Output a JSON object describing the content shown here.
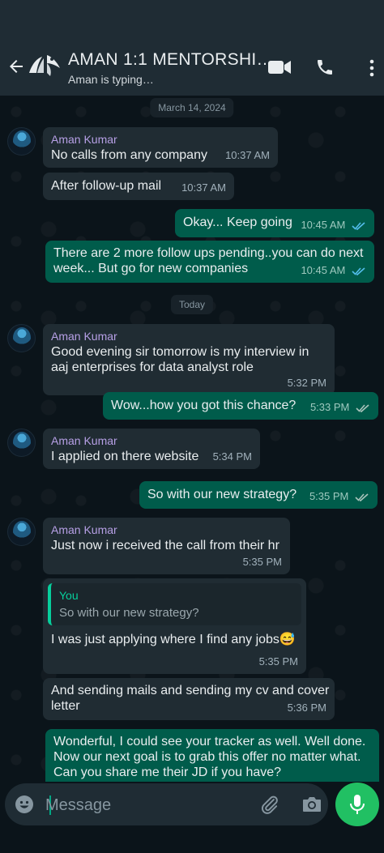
{
  "header": {
    "title": "AMAN 1:1 MENTORSHI…",
    "status": "Aman is typing…"
  },
  "chat": {
    "dates": [
      "March 14, 2024",
      "Today"
    ],
    "messages": [
      {
        "dir": "in",
        "sender": "Aman Kumar",
        "text": "No calls from any company",
        "time": "10:37 AM"
      },
      {
        "dir": "in",
        "text": "After follow-up mail",
        "time": "10:37 AM"
      },
      {
        "dir": "out",
        "text": "Okay... Keep going",
        "time": "10:45 AM"
      },
      {
        "dir": "out",
        "text": "There are 2 more follow ups pending..you can do next week... But go for new companies",
        "time": "10:45 AM"
      },
      {
        "dir": "in",
        "sender": "Aman Kumar",
        "text": "Good evening sir tomorrow is my interview in aaj enterprises for data analyst role",
        "time": "5:32 PM"
      },
      {
        "dir": "out",
        "text": "Wow...how you got this chance?",
        "time": "5:33 PM"
      },
      {
        "dir": "in",
        "sender": "Aman Kumar",
        "text": "I applied on there website",
        "time": "5:34 PM"
      },
      {
        "dir": "out",
        "text": "So with our new strategy?",
        "time": "5:35 PM"
      },
      {
        "dir": "in",
        "sender": "Aman Kumar",
        "text": "Just now i received the call from their hr",
        "time": "5:35 PM"
      },
      {
        "dir": "in",
        "quote_name": "You",
        "quote_text": "So with our new strategy?",
        "text": "I was just applying where I find any jobs😅",
        "time": "5:35 PM"
      },
      {
        "dir": "in",
        "text": "And sending mails and sending my cv and cover letter",
        "time": "5:36 PM"
      },
      {
        "dir": "out",
        "text": "Wonderful, I could see your tracker as well. Well done. Now our next goal is to grab this offer no matter what. Can you share me their JD if you have?",
        "time": ""
      }
    ]
  },
  "composer": {
    "placeholder": "Message"
  },
  "icons": [
    "back-arrow-icon",
    "video-call-icon",
    "phone-icon",
    "more-menu-icon",
    "emoji-icon",
    "attach-icon",
    "camera-icon",
    "mic-icon",
    "double-tick-icon"
  ],
  "colors": {
    "header": "#1f2c34",
    "background": "#0b141a",
    "incoming": "#202c33",
    "outgoing": "#005c4b",
    "accent": "#00a884",
    "sender_name": "#b7a0e6",
    "read_tick": "#53bdeb"
  }
}
